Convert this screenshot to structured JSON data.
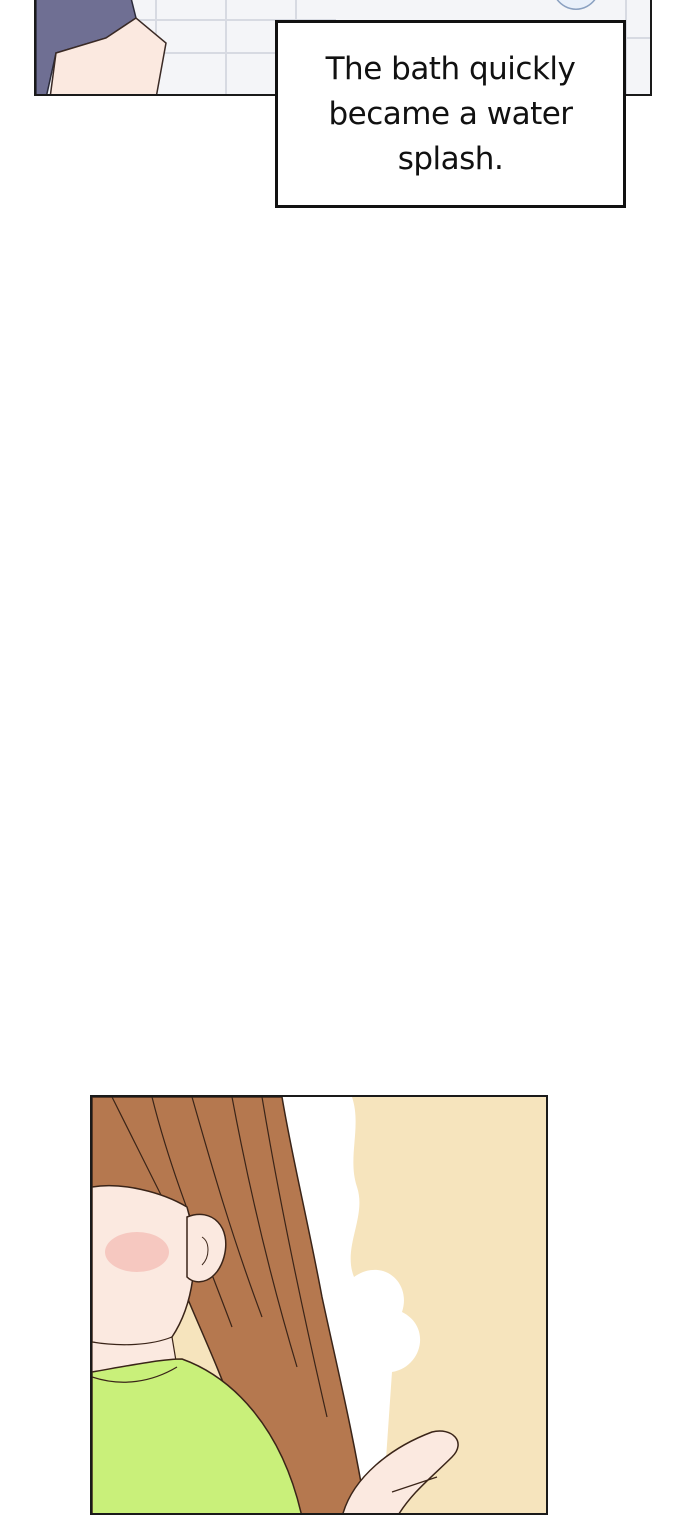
{
  "caption": {
    "text": "The bath quickly became a water splash."
  },
  "colors": {
    "page_background": "#ffffff",
    "panel_border": "#1a1a1a",
    "bottom_panel_background": "#f6e4bd",
    "hair": "#b5784f",
    "shirt": "#c9f07a",
    "skin": "#fbe9e0",
    "sleeve": "#6f6f93"
  },
  "panels": [
    {
      "name": "top-bath-panel",
      "depicts": "sleeve-and-tiles"
    },
    {
      "name": "bottom-girl-panel",
      "depicts": "girl-with-brown-hair-green-shirt"
    }
  ]
}
